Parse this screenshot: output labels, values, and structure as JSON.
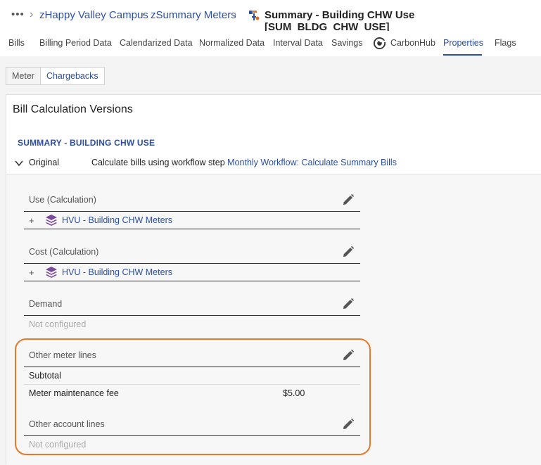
{
  "breadcrumb": {
    "more": "•••",
    "items": [
      "zHappy Valley Campus",
      "zSummary Meters"
    ],
    "title": "Summary - Building CHW Use [SUM_BLDG_CHW_USE]"
  },
  "tabs": [
    "Bills",
    "Billing Period Data",
    "Calendarized Data",
    "Normalized Data",
    "Interval Data",
    "Savings",
    "CarbonHub",
    "Properties",
    "Flags"
  ],
  "active_tab": "Properties",
  "subtabs": [
    "Meter",
    "Chargebacks"
  ],
  "active_subtab": "Chargebacks",
  "card": {
    "title": "Bill Calculation Versions",
    "section_title": "SUMMARY - BUILDING CHW USE",
    "version": {
      "name": "Original",
      "desc_prefix": "Calculate bills using workflow step",
      "desc_link": "Monthly Workflow: Calculate Summary Bills"
    }
  },
  "blocks": {
    "use": {
      "label": "Use (Calculation)",
      "expand": "+",
      "item": "HVU - Building CHW Meters"
    },
    "cost": {
      "label": "Cost (Calculation)",
      "expand": "+",
      "item": "HVU - Building CHW Meters"
    },
    "demand": {
      "label": "Demand",
      "status": "Not configured"
    },
    "other_meter": {
      "label": "Other meter lines",
      "subtotal": "Subtotal",
      "fee_label": "Meter maintenance fee",
      "fee_value": "$5.00"
    },
    "other_account": {
      "label": "Other account lines",
      "status": "Not configured"
    }
  },
  "colors": {
    "accent": "#2d4fa0",
    "highlight": "#e8782a",
    "layers_icon": "#7b4a9a"
  },
  "icons": [
    "more-icon",
    "chevron-right-icon",
    "meter-icon",
    "carbonhub-icon",
    "chevron-down-icon",
    "pencil-icon",
    "layers-icon"
  ]
}
